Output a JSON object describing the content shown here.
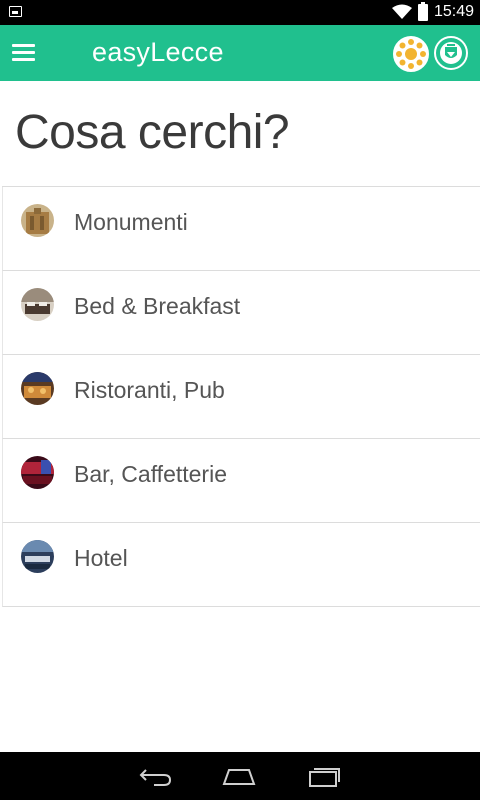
{
  "status_bar": {
    "time": "15:49",
    "icons": [
      "notification-icon",
      "wifi-icon",
      "battery-icon"
    ]
  },
  "app_bar": {
    "title": "easyLecce",
    "color": "#20c08e",
    "menu_icon": "menu-icon",
    "logos": [
      "sun-logo",
      "coat-of-arms-logo"
    ]
  },
  "page": {
    "heading": "Cosa cerchi?"
  },
  "categories": [
    {
      "label": "Monumenti",
      "thumb_color": "#a67c44"
    },
    {
      "label": "Bed & Breakfast",
      "thumb_color": "#7a6a5c"
    },
    {
      "label": "Ristoranti, Pub",
      "thumb_color": "#b06a2c"
    },
    {
      "label": "Bar, Caffetterie",
      "thumb_color": "#8c1e2c"
    },
    {
      "label": "Hotel",
      "thumb_color": "#3d5a80"
    }
  ],
  "nav_bar": {
    "buttons": [
      "back-icon",
      "home-icon",
      "recent-apps-icon"
    ]
  }
}
